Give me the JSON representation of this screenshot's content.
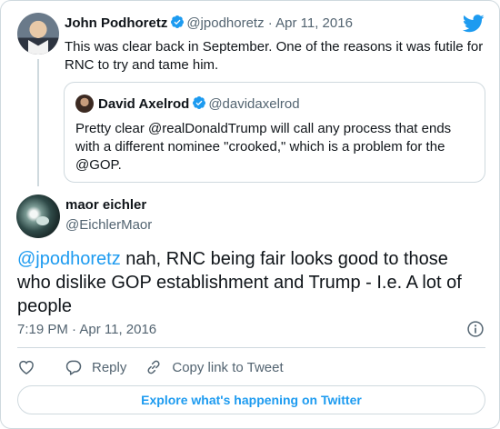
{
  "parent_tweet": {
    "author_name": "John Podhoretz",
    "author_handle": "@jpodhoretz",
    "date_sep": " · ",
    "date": "Apr 11, 2016",
    "text": "This was clear back in September. One of the reasons it was futile for RNC to try and tame him."
  },
  "quoted_tweet": {
    "author_name": "David Axelrod",
    "author_handle": "@davidaxelrod",
    "text": "Pretty clear @realDonaldTrump will call any process that ends with a different nominee \"crooked,\" which is a problem for the @GOP."
  },
  "main_tweet": {
    "author_name": "maor eichler",
    "author_handle": "@EichlerMaor",
    "mention": "@jpodhoretz",
    "text": " nah, RNC being fair looks good to those who dislike GOP establishment and Trump - I.e. A lot of people",
    "timestamp": "7:19 PM · Apr 11, 2016"
  },
  "actions": {
    "reply_label": "Reply",
    "copy_label": "Copy link to Tweet"
  },
  "explore_label": "Explore what's happening on Twitter",
  "colors": {
    "accent": "#1d9bf0",
    "text": "#0f1419",
    "muted": "#536471",
    "border": "#cfd9de"
  },
  "icons": [
    "twitter-bird-icon",
    "verified-badge-icon",
    "info-icon",
    "heart-icon",
    "reply-icon",
    "link-icon"
  ]
}
